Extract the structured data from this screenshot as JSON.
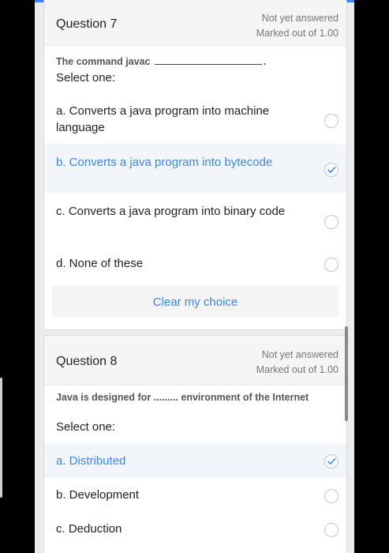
{
  "colors": {
    "accent": "#3b87e0",
    "top_bar": "#3a86f5",
    "card_header": "#f5f5f5",
    "selected_option_bg": "#f2f6fb"
  },
  "questions": [
    {
      "title": "Question 7",
      "status": "Not yet answered",
      "mark": "Marked out of 1.00",
      "text_before_blank": "The command javac",
      "text_after_blank": ".",
      "select_one": "Select one:",
      "options": [
        {
          "label": "a. Converts a java program into machine language",
          "selected": false
        },
        {
          "label": "b. Converts a java program into bytecode",
          "selected": true
        },
        {
          "label": "c. Converts a java program into binary code",
          "selected": false
        },
        {
          "label": "d. None of these",
          "selected": false
        }
      ],
      "clear_label": "Clear my choice"
    },
    {
      "title": "Question 8",
      "status": "Not yet answered",
      "mark": "Marked out of 1.00",
      "text": "Java is designed for ......... environment of the Internet",
      "select_one": "Select one:",
      "options": [
        {
          "label": "a. Distributed",
          "selected": true
        },
        {
          "label": "b. Development",
          "selected": false
        },
        {
          "label": "c. Deduction",
          "selected": false
        }
      ]
    }
  ]
}
